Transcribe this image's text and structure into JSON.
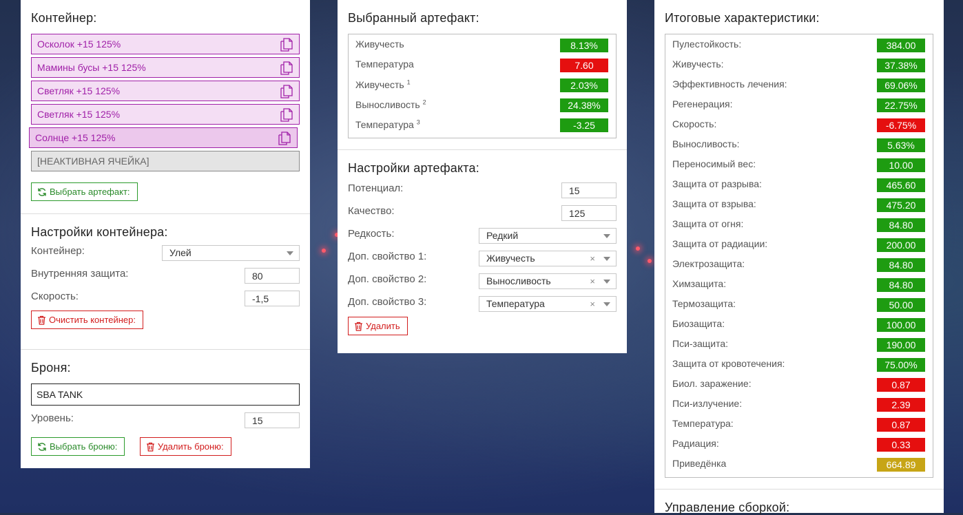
{
  "container_panel": {
    "title": "Контейнер:",
    "slots": [
      {
        "label": "Осколок +15 125%"
      },
      {
        "label": "Мамины бусы +15 125%"
      },
      {
        "label": "Светляк +15 125%"
      },
      {
        "label": "Светляк +15 125%"
      },
      {
        "label": "Солнце +15 125%"
      }
    ],
    "inactive_slot": "[НЕАКТИВНАЯ ЯЧЕЙКА]",
    "choose_artifact_button": "Выбрать артефакт:"
  },
  "container_settings": {
    "title": "Настройки контейнера:",
    "container_label": "Контейнер:",
    "container_value": "Улей",
    "inner_protection_label": "Внутренняя защита:",
    "inner_protection_value": "80",
    "speed_label": "Скорость:",
    "speed_value": "-1,5",
    "clear_button": "Очистить контейнер:"
  },
  "armor": {
    "title": "Броня:",
    "name_value": "SBA TANK",
    "level_label": "Уровень:",
    "level_value": "15",
    "choose_button": "Выбрать броню:",
    "delete_button": "Удалить броню:"
  },
  "selected_artifact": {
    "title": "Выбранный артефакт:",
    "stats": [
      {
        "label": "Живучесть",
        "sup": "",
        "value": "8.13%",
        "color": "#1e9c11"
      },
      {
        "label": "Температура",
        "sup": "",
        "value": "7.60",
        "color": "#e50f0f"
      },
      {
        "label": "Живучесть",
        "sup": "1",
        "value": "2.03%",
        "color": "#1e9c11"
      },
      {
        "label": "Выносливость",
        "sup": "2",
        "value": "24.38%",
        "color": "#1e9c11"
      },
      {
        "label": "Температура",
        "sup": "3",
        "value": "-3.25",
        "color": "#1e9c11"
      }
    ]
  },
  "artifact_settings": {
    "title": "Настройки артефакта:",
    "potential_label": "Потенциал:",
    "potential_value": "15",
    "quality_label": "Качество:",
    "quality_value": "125",
    "rarity_label": "Редкость:",
    "rarity_value": "Редкий",
    "extra1_label": "Доп. свойство 1:",
    "extra1_value": "Живучесть",
    "extra2_label": "Доп. свойство 2:",
    "extra2_value": "Выносливость",
    "extra3_label": "Доп. свойство 3:",
    "extra3_value": "Температура",
    "clear_glyph": "×",
    "delete_button": "Удалить"
  },
  "totals": {
    "title": "Итоговые характеристики:",
    "stats": [
      {
        "label": "Пулестойкость:",
        "value": "384.00",
        "color": "#1e9c11"
      },
      {
        "label": "Живучесть:",
        "value": "37.38%",
        "color": "#1e9c11"
      },
      {
        "label": "Эффективность лечения:",
        "value": "69.06%",
        "color": "#1e9c11"
      },
      {
        "label": "Регенерация:",
        "value": "22.75%",
        "color": "#1e9c11"
      },
      {
        "label": "Скорость:",
        "value": "-6.75%",
        "color": "#e50f0f"
      },
      {
        "label": "Выносливость:",
        "value": "5.63%",
        "color": "#1e9c11"
      },
      {
        "label": "Переносимый вес:",
        "value": "10.00",
        "color": "#1e9c11"
      },
      {
        "label": "Защита от разрыва:",
        "value": "465.60",
        "color": "#1e9c11"
      },
      {
        "label": "Защита от взрыва:",
        "value": "475.20",
        "color": "#1e9c11"
      },
      {
        "label": "Защита от огня:",
        "value": "84.80",
        "color": "#1e9c11"
      },
      {
        "label": "Защита от радиации:",
        "value": "200.00",
        "color": "#1e9c11"
      },
      {
        "label": "Электрозащита:",
        "value": "84.80",
        "color": "#1e9c11"
      },
      {
        "label": "Химзащита:",
        "value": "84.80",
        "color": "#1e9c11"
      },
      {
        "label": "Термозащита:",
        "value": "50.00",
        "color": "#1e9c11"
      },
      {
        "label": "Биозащита:",
        "value": "100.00",
        "color": "#1e9c11"
      },
      {
        "label": "Пси-защита:",
        "value": "190.00",
        "color": "#1e9c11"
      },
      {
        "label": "Защита от кровотечения:",
        "value": "75.00%",
        "color": "#1e9c11"
      },
      {
        "label": "Биол. заражение:",
        "value": "0.87",
        "color": "#e50f0f"
      },
      {
        "label": "Пси-излучение:",
        "value": "2.39",
        "color": "#e50f0f"
      },
      {
        "label": "Температура:",
        "value": "0.87",
        "color": "#e50f0f"
      },
      {
        "label": "Радиация:",
        "value": "0.33",
        "color": "#e50f0f"
      },
      {
        "label": "Приведёнка",
        "value": "664.89",
        "color": "#c7a516"
      }
    ],
    "build_title": "Управление сборкой:"
  }
}
